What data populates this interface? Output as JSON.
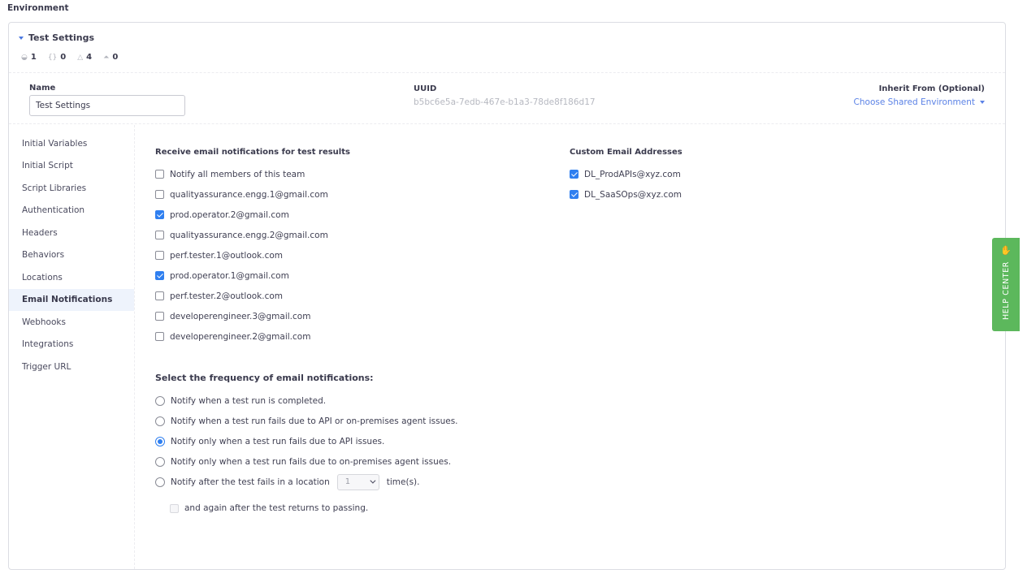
{
  "page": {
    "title": "Environment"
  },
  "panel": {
    "title": "Test Settings",
    "stats": [
      {
        "icon": "globe-icon",
        "glyph": "◒",
        "value": "1"
      },
      {
        "icon": "braces-icon",
        "glyph": "{}",
        "value": "0"
      },
      {
        "icon": "bell-icon",
        "glyph": "△",
        "value": "4"
      },
      {
        "icon": "flask-icon",
        "glyph": "⏶",
        "value": "0"
      }
    ]
  },
  "meta": {
    "name_label": "Name",
    "name_value": "Test Settings",
    "uuid_label": "UUID",
    "uuid_value": "b5bc6e5a-7edb-467e-b1a3-78de8f186d17",
    "inherit_label": "Inherit From (Optional)",
    "inherit_link": "Choose Shared Environment"
  },
  "sidenav": {
    "items": [
      {
        "label": "Initial Variables",
        "active": false
      },
      {
        "label": "Initial Script",
        "active": false
      },
      {
        "label": "Script Libraries",
        "active": false
      },
      {
        "label": "Authentication",
        "active": false
      },
      {
        "label": "Headers",
        "active": false
      },
      {
        "label": "Behaviors",
        "active": false
      },
      {
        "label": "Locations",
        "active": false
      },
      {
        "label": "Email Notifications",
        "active": true
      },
      {
        "label": "Webhooks",
        "active": false
      },
      {
        "label": "Integrations",
        "active": false
      },
      {
        "label": "Trigger URL",
        "active": false
      }
    ]
  },
  "notifications": {
    "title": "Receive email notifications for test results",
    "recipients": [
      {
        "label": "Notify all members of this team",
        "checked": false
      },
      {
        "label": "qualityassurance.engg.1@gmail.com",
        "checked": false
      },
      {
        "label": "prod.operator.2@gmail.com",
        "checked": true
      },
      {
        "label": "qualityassurance.engg.2@gmail.com",
        "checked": false
      },
      {
        "label": "perf.tester.1@outlook.com",
        "checked": false
      },
      {
        "label": "prod.operator.1@gmail.com",
        "checked": true
      },
      {
        "label": "perf.tester.2@outlook.com",
        "checked": false
      },
      {
        "label": "developerengineer.3@gmail.com",
        "checked": false
      },
      {
        "label": "developerengineer.2@gmail.com",
        "checked": false
      }
    ],
    "custom_title": "Custom Email Addresses",
    "custom": [
      {
        "label": "DL_ProdAPIs@xyz.com",
        "checked": true
      },
      {
        "label": "DL_SaaSOps@xyz.com",
        "checked": true
      }
    ]
  },
  "frequency": {
    "title": "Select the frequency of email notifications:",
    "options": [
      {
        "label": "Notify when a test run is completed.",
        "selected": false
      },
      {
        "label": "Notify when a test run fails due to API or on-premises agent issues.",
        "selected": false
      },
      {
        "label": "Notify only when a test run fails due to API issues.",
        "selected": true
      },
      {
        "label": "Notify only when a test run fails due to on-premises agent issues.",
        "selected": false
      }
    ],
    "location_option": {
      "prefix": "Notify after the test fails in a location",
      "count": "1",
      "suffix": "time(s).",
      "selected": false
    },
    "again_label": "and again after the test returns to passing.",
    "again_checked": false
  },
  "help": {
    "label": "HELP CENTER",
    "icon": "waving-hand-icon",
    "glyph": "✋"
  },
  "colors": {
    "accent": "#2f7ff0",
    "link": "#5b82e6",
    "help": "#5cb85c",
    "active_nav": "#eef3fc"
  }
}
